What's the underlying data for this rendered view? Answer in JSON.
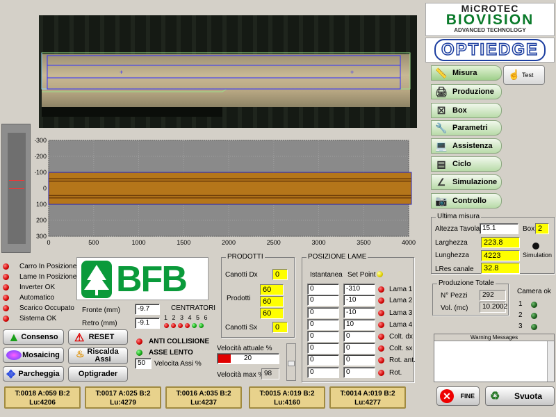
{
  "logos": {
    "microtec_line1": "MiCROTEC",
    "microtec_line2": "BIOVISION",
    "microtec_line3": "ADVANCED TECHNOLOGY",
    "optiedge": "OPTIEDGE",
    "bfb": "BFB"
  },
  "menu": {
    "items": [
      {
        "label": "Misura",
        "icon": "ruler-icon"
      },
      {
        "label": "Produzione",
        "icon": "printer-icon"
      },
      {
        "label": "Box",
        "icon": "box-icon"
      },
      {
        "label": "Parametri",
        "icon": "wrench-icon"
      },
      {
        "label": "Assistenza",
        "icon": "computer-icon"
      },
      {
        "label": "Ciclo",
        "icon": "list-icon"
      },
      {
        "label": "Simulazione",
        "icon": "simulation-icon"
      },
      {
        "label": "Controllo",
        "icon": "camera-icon"
      }
    ],
    "test_label": "Test"
  },
  "chart_data": {
    "type": "area",
    "x_ticks": [
      "0",
      "500",
      "1000",
      "1500",
      "2000",
      "2500",
      "3000",
      "3500",
      "4000"
    ],
    "y_ticks": [
      "-300",
      "-200",
      "-100",
      "0",
      "100",
      "200",
      "300"
    ],
    "xlim": [
      0,
      4000
    ],
    "ylim": [
      -300,
      300
    ],
    "board_extent_x": [
      0,
      4030
    ],
    "board_top": -100,
    "board_bottom": 100,
    "cut_lines": [
      -60,
      -45,
      45,
      60
    ]
  },
  "ultima_misura": {
    "title": "Ultima misura",
    "altezza_label": "Altezza Tavola",
    "altezza_value": "15.1",
    "box_label": "Box",
    "box_value": "2",
    "larghezza_label": "Larghezza",
    "larghezza_value": "223.8",
    "lunghezza_label": "Lunghezza",
    "lunghezza_value": "4223",
    "simulation_label": "Simulation",
    "lres_label": "LRes canale",
    "lres_value": "32.8"
  },
  "produzione": {
    "title": "Produzione Totale",
    "pezzi_label": "N° Pezzi",
    "pezzi_value": "292",
    "vol_label": "Vol. (mc)",
    "vol_value": "10.2002"
  },
  "camera_ok": {
    "title": "Camera ok",
    "cams": [
      "1",
      "2",
      "3"
    ]
  },
  "warning": {
    "title": "Warning Messages"
  },
  "status_leds": [
    {
      "label": "Carro In Posizione",
      "color": "red"
    },
    {
      "label": "Lame In Posizione",
      "color": "red"
    },
    {
      "label": "Inverter OK",
      "color": "red"
    },
    {
      "label": "Automatico",
      "color": "red"
    },
    {
      "label": "Scarico Occupato",
      "color": "red"
    },
    {
      "label": "Sistema OK",
      "color": "red"
    }
  ],
  "fronte": {
    "label": "Fronte (mm)",
    "value": "-9.7"
  },
  "retro": {
    "label": "Retro (mm)",
    "value": "-9.1"
  },
  "centratori": {
    "label": "CENTRATORI",
    "numbers": "1 2 3 4 5 6"
  },
  "anti_collisione": "ANTI COLLISIONE",
  "asse_lento": "ASSE LENTO",
  "velocita_assi": {
    "value": "50",
    "label": "Velocita Assi %"
  },
  "buttons": {
    "consenso": "Consenso",
    "reset": "RESET",
    "mosaicing": "Mosaicing",
    "riscalda": "Riscalda Assi",
    "parcheggia": "Parcheggia",
    "optigrader": "Optigrader",
    "fine": "FINE",
    "svuota": "Svuota"
  },
  "prodotti": {
    "title": "PRODOTTI",
    "canotti_dx_label": "Canotti Dx",
    "canotti_dx_value": "0",
    "prodotti_label": "Prodotti",
    "prodotti_values": [
      "60",
      "60",
      "60"
    ],
    "canotti_sx_label": "Canotti Sx",
    "canotti_sx_value": "0"
  },
  "velocita": {
    "attuale_label": "Velocità attuale %",
    "attuale_value": "20",
    "attuale_fraction": 0.2,
    "max_label": "Velocità max %",
    "max_value": "98"
  },
  "posizione_lame": {
    "title": "POSIZIONE LAME",
    "istantanea_label": "Istantanea",
    "setpoint_label": "Set Point",
    "rows": [
      {
        "ist": "0",
        "set": "-310",
        "label": "Lama 1"
      },
      {
        "ist": "0",
        "set": "-10",
        "label": "Lama 2"
      },
      {
        "ist": "0",
        "set": "-10",
        "label": "Lama 3"
      },
      {
        "ist": "0",
        "set": "10",
        "label": "Lama 4"
      },
      {
        "ist": "0",
        "set": "0",
        "label": "Colt. dx"
      },
      {
        "ist": "0",
        "set": "0",
        "label": "Colt. sx"
      },
      {
        "ist": "0",
        "set": "0",
        "label": "Rot. ant."
      },
      {
        "ist": "0",
        "set": "0",
        "label": "Rot."
      }
    ]
  },
  "status_bar": [
    {
      "line1": "T:0018 A:059 B:2",
      "line2": "Lu:4206"
    },
    {
      "line1": "T:0017 A:025 B:2",
      "line2": "Lu:4279"
    },
    {
      "line1": "T:0016 A:035 B:2",
      "line2": "Lu:4237"
    },
    {
      "line1": "T:0015 A:019 B:2",
      "line2": "Lu:4160"
    },
    {
      "line1": "T:0014 A:019 B:2",
      "line2": "Lu:4277"
    }
  ]
}
